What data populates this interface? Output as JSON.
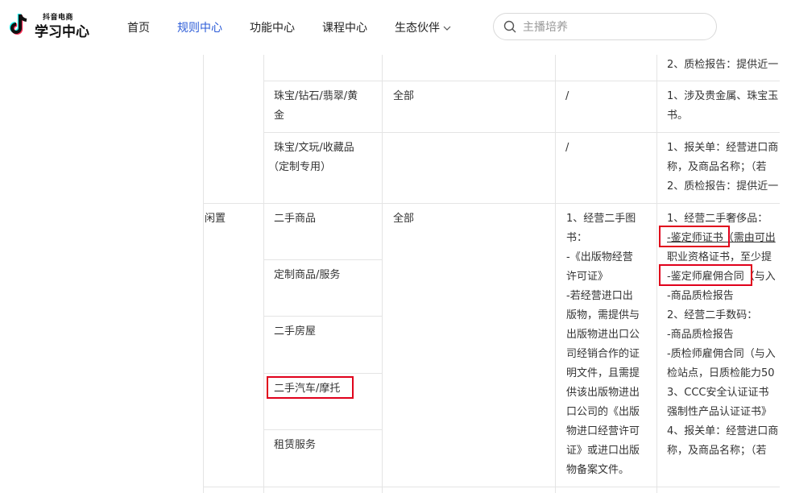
{
  "header": {
    "logo_small": "抖音电商",
    "logo_big": "学习中心",
    "nav": [
      "首页",
      "规则中心",
      "功能中心",
      "课程中心",
      "生态伙伴"
    ],
    "active_nav": "规则中心",
    "search_placeholder": "主播培养"
  },
  "table": {
    "top_row": {
      "col4": "2、质检报告：提供近一"
    },
    "row_jewelry_gold": {
      "col2_line1": "珠宝/钻石/翡翠/黄",
      "col2_line2": "金",
      "col3": "全部",
      "col4": "/",
      "col5_line1": "1、涉及贵金属、珠宝玉",
      "col5_line2": "书。"
    },
    "row_jewelry_custom": {
      "col2_line1": "珠宝/文玩/收藏品",
      "col2_line2": "（定制专用）",
      "col4": "/",
      "col5_line1": "1、报关单：经营进口商",
      "col5_line2": "称，及商品名称；（若",
      "col5_line3": "2、质检报告：提供近一"
    },
    "section_idle": {
      "col1": "闲置",
      "col3": "全部",
      "subcats": [
        "二手商品",
        "定制商品/服务",
        "二手房屋",
        "二手汽车/摩托",
        "租赁服务"
      ],
      "col4_lines": [
        "1、经营二手图",
        "书：",
        "-《出版物经营",
        "许可证》",
        "-若经营进口出",
        "版物，需提供与",
        "出版物进出口公",
        "司经销合作的证",
        "明文件，且需提",
        "供该出版物进出",
        "口公司的《出版",
        "物进口经营许可",
        "证》或进口出版",
        "物备案文件。"
      ],
      "col5_lines": [
        "1、经营二手奢侈品：",
        "-鉴定师证书（需由可出",
        "职业资格证书，至少提",
        "-鉴定师雇佣合同（与入",
        "-商品质检报告",
        "2、经营二手数码：",
        "-商品质检报告",
        "-质检师雇佣合同（与入",
        "检站点，日质检能力50",
        " 3、CCC安全认证证书",
        "强制性产品认证证书》",
        "4、报关单：经营进口商",
        "称，及商品名称；（若"
      ]
    }
  },
  "colors": {
    "accent": "#2b5bd7",
    "highlight": "#e0001b",
    "border": "#e4e4e4"
  }
}
